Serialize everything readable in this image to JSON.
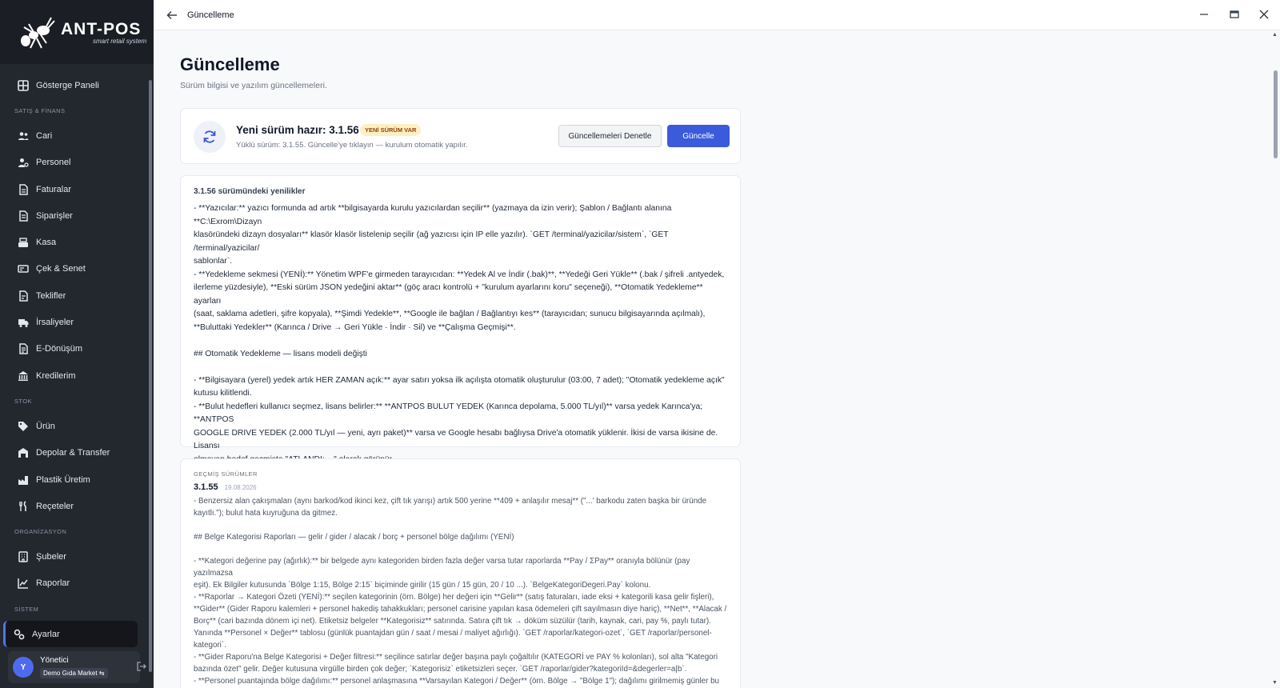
{
  "app": {
    "name": "ANT-POS",
    "tagline": "smart retail system"
  },
  "window": {
    "title": "Güncelleme"
  },
  "sidebar": {
    "top": {
      "label": "Gösterge Paneli"
    },
    "sections": [
      {
        "title": "SATIŞ & FİNANS",
        "items": [
          "Cari",
          "Personel",
          "Faturalar",
          "Siparişler",
          "Kasa",
          "Çek & Senet",
          "Teklifler",
          "İrsaliyeler",
          "E-Dönüşüm",
          "Kredilerim"
        ]
      },
      {
        "title": "STOK",
        "items": [
          "Ürün",
          "Depolar & Transfer",
          "Plastik Üretim",
          "Reçeteler"
        ]
      },
      {
        "title": "ORGANİZASYON",
        "items": [
          "Şubeler",
          "Raporlar"
        ]
      },
      {
        "title": "SİSTEM",
        "items": [
          "Ayarlar"
        ]
      }
    ],
    "user": {
      "initial": "Y",
      "name": "Yönetici",
      "org": "Demo Gıda Market ⇆"
    }
  },
  "page": {
    "title": "Güncelleme",
    "subtitle": "Sürüm bilgisi ve yazılım güncellemeleri."
  },
  "update_card": {
    "title": "Yeni sürüm hazır: 3.1.56",
    "badge": "YENİ SÜRÜM VAR",
    "desc": "Yüklü sürüm: 3.1.55. Güncelle'ye tıklayın — kurulum otomatik yapılır.",
    "check_label": "Güncellemeleri Denetle",
    "update_label": "Güncelle"
  },
  "whats_new": {
    "title": "3.1.56 sürümündeki yenilikler",
    "body": "- **Yazıcılar:** yazıcı formunda ad artık **bilgisayarda kurulu yazıcılardan seçilir** (yazmaya da izin verir); Şablon / Bağlantı alanına **C:\\Exrom\\Dizayn\nklasöründeki dizayn dosyaları** klasör klasör listelenip seçilir (ağ yazıcısı için IP elle yazılır). `GET /terminal/yazicilar/sistem`, `GET /terminal/yazicilar/\nsablonlar`.\n- **Yedekleme sekmesi (YENİ):** Yönetim WPF'e girmeden tarayıcıdan: **Yedek Al ve İndir (.bak)**, **Yedeği Geri Yükle** (.bak / şifreli .antyedek,\nilerleme yüzdesiyle), **Eski sürüm JSON yedeğini aktar** (göç aracı kontrolü + \"kurulum ayarlarını koru\" seçeneği), **Otomatik Yedekleme** ayarları\n(saat, saklama adetleri, şifre kopyala), **Şimdi Yedekle**, **Google ile bağlan / Bağlantıyı kes** (tarayıcıdan; sunucu bilgisayarında açılmalı),\n**Buluttaki Yedekler** (Karınca / Drive → Geri Yükle · İndir · Sil) ve **Çalışma Geçmişi**.\n\n## Otomatik Yedekleme — lisans modeli değişti\n\n- **Bilgisayara (yerel) yedek artık HER ZAMAN açık:** ayar satırı yoksa ilk açılışta otomatik oluşturulur (03:00, 7 adet); \"Otomatik yedekleme açık\"\nkutusu kilitlendi.\n- **Bulut hedefleri kullanıcı seçmez, lisans belirler:** **ANTPOS BULUT YEDEK (Karınca depolama, 5.000 TL/yıl)** varsa yedek Karınca'ya; **ANTPOS\nGOOGLE DRIVE YEDEK (2.000 TL/yıl — yeni, ayrı paket)** varsa ve Google hesabı bağlıysa Drive'a otomatik yüklenir. İkisi de varsa ikisine de. Lisansı\nolmayan hedef geçmişte \"ATLANDI: ...\" olarak görünür.\n- Yönetim WPF Bulut Yedekleme ekranı aynı kurala göre düzenlendi (hedef kutuları durumu gösterir, tıklanamaz). Karınca tarafı: yeni paket\n`c2e2c2e2-0009` → JWT `ModulYedekDrive`; `drive-istemci` ve `sifre` uçları iki paketten biriyle açılır (SQL: `antpos-google-drive-yedek-paketi.sql`,\ndeploy gerekir)."
  },
  "previous": {
    "label": "GEÇMİŞ SÜRÜMLER",
    "version": "3.1.55",
    "date": "19.08.2026",
    "body": "- Benzersiz alan çakışmaları (aynı barkod/kod ikinci kez, çift tık yarışı) artık 500 yerine **409 + anlaşılır mesaj** (\"...' barkodu zaten başka bir üründe\nkayıtlı.\"); bulut hata kuyruğuna da gitmez.\n\n## Belge Kategorisi Raporları — gelir / gider / alacak / borç + personel bölge dağılımı (YENİ)\n\n- **Kategori değerine pay (ağırlık):** bir belgede aynı kategoriden birden fazla değer varsa tutar raporlarda **Pay / ΣPay** oranıyla bölünür (pay yazılmazsa\neşit). Ek Bilgiler kutusunda `Bölge 1:15, Bölge 2:15` biçiminde girilir (15 gün / 15 gün, 20 / 10 ...). `BelgeKategoriDegeri.Pay` kolonu.\n- **Raporlar → Kategori Özeti (YENİ):** seçilen kategorinin (örn. Bölge) her değeri için **Gelir** (satış faturaları, iade eksi + kategorili kasa gelir fişleri),\n**Gider** (Gider Raporu kalemleri + personel hakediş tahakkukları; personel carisine yapılan kasa ödemeleri çift sayılmasın diye hariç), **Net**, **Alacak /\nBorç** (cari bazında dönem içi net). Etiketsiz belgeler **Kategorisiz** satırında. Satıra çift tık → döküm süzülür (tarih, kaynak, cari, pay %, paylı tutar).\nYanında **Personel × Değer** tablosu (günlük puantajdan gün / saat / mesai / maliyet ağırlığı). `GET /raporlar/kategori-ozet`, `GET /raporlar/personel-\nkategori`.\n- **Gider Raporu'na Belge Kategorisi + Değer filtresi:** seçilince satırlar değer başına paylı çoğaltılır (KATEGORİ ve PAY % kolonları), sol alta \"Kategori\nbazında özet\" gelir. Değer kutusuna virgülle birden çok değer; `Kategorisiz` etiketsizleri seçer. `GET /raporlar/gider?kategoriId=&degerler=a|b`.\n- **Personel puantajında bölge dağılımı:** personel anlaşmasına **Varsayılan Kategori / Değer** (örn. Bölge → \"Bölge 1\"); dağılımı girilmemiş günler bu"
  }
}
